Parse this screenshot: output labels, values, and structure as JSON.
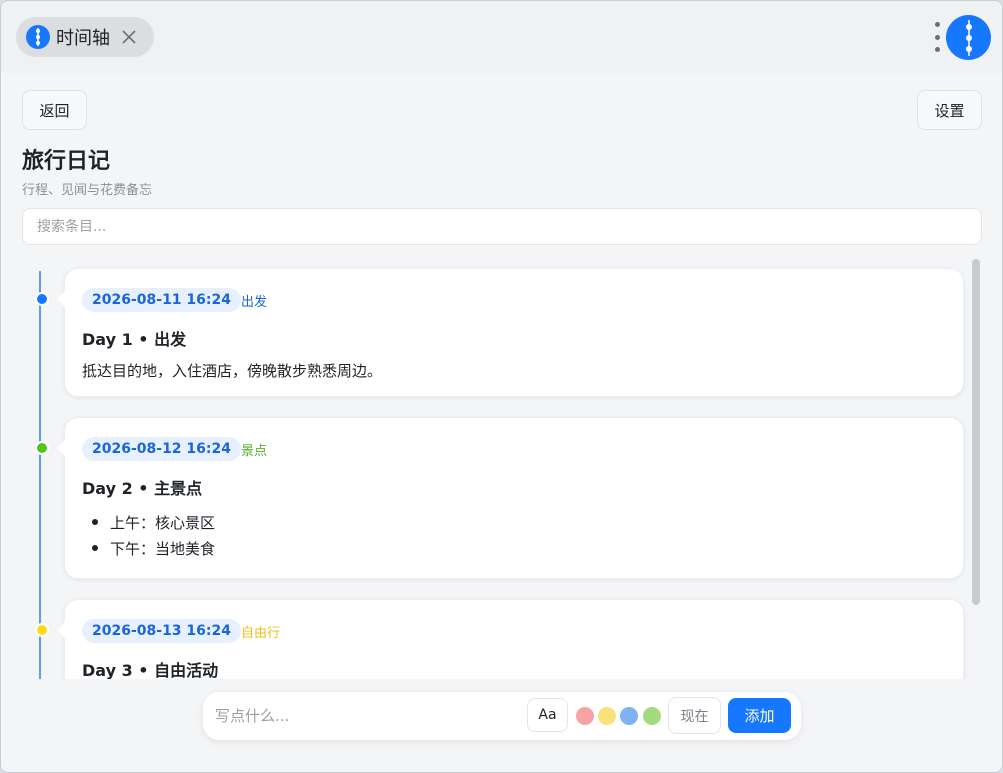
{
  "window": {
    "tab_title": "时间轴"
  },
  "toolbar": {
    "back_label": "返回",
    "settings_label": "设置"
  },
  "page": {
    "title": "旅行日记",
    "subtitle": "行程、见闻与花费备忘"
  },
  "search": {
    "placeholder": "搜索条目..."
  },
  "entries": [
    {
      "date": "2026-08-11 16:24",
      "tag": "出发",
      "tag_color": "#1a66d9",
      "dot_color": "#1677ff",
      "title": "Day 1 • 出发",
      "body": "抵达目的地，入住酒店，傍晚散步熟悉周边。"
    },
    {
      "date": "2026-08-12 16:24",
      "tag": "景点",
      "tag_color": "#52b22a",
      "dot_color": "#52c41a",
      "title": "Day 2 • 主景点",
      "list": [
        "上午：核心景区",
        "下午：当地美食"
      ]
    },
    {
      "date": "2026-08-13 16:24",
      "tag": "自由行",
      "tag_color": "#e6c21a",
      "dot_color": "#fadb14",
      "title": "Day 3 • 自由活动"
    }
  ],
  "composer": {
    "placeholder": "写点什么...",
    "font_button": "Aa",
    "swatches": [
      "#f5a3a3",
      "#f9e27a",
      "#7fb2f0",
      "#a3dc7f"
    ],
    "now_label": "现在",
    "add_label": "添加"
  },
  "colors": {
    "accent": "#1677ff"
  }
}
